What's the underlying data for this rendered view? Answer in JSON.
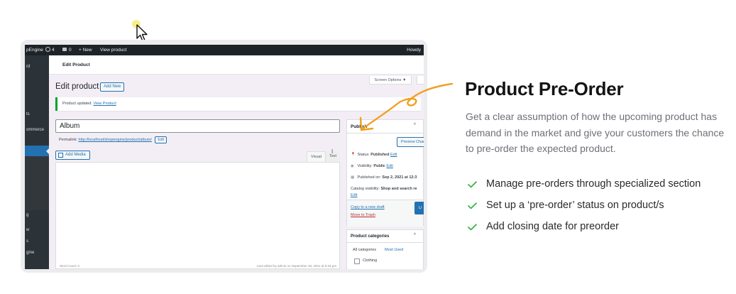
{
  "cursor": {
    "icon": "mouse-pointer-icon"
  },
  "wp": {
    "admin_bar": {
      "brand": "pEngine",
      "updates_count": "4",
      "comments_count": "0",
      "new_label": "+ New",
      "view_product": "View product",
      "howdy": "Howdy"
    },
    "sidebar_items": [
      "rd",
      "ts",
      "ommerce",
      "g",
      "w",
      "s",
      "gine"
    ],
    "top_title": "Edit Product",
    "screen_options": "Screen Options ▼",
    "page_title": "Edit product",
    "add_new": "Add New",
    "notice_text": "Product updated.",
    "notice_link": "View Product",
    "title_value": "Album",
    "permalink_label": "Permalink:",
    "permalink_url": "http://localhost/shopengine/product/album/",
    "permalink_edit": "Edit",
    "add_media": "Add Media",
    "tab_visual": "Visual",
    "tab_text": "Text",
    "editor_footer_left": "Word count: 0",
    "editor_footer_right": "Last edited by admin on September 28, 2021 at 5:33 pm",
    "publish": {
      "heading": "Publish",
      "preview": "Preview Changes",
      "status_label": "Status:",
      "status_value": "Published",
      "status_edit": "Edit",
      "visibility_label": "Visibility:",
      "visibility_value": "Public",
      "visibility_edit": "Edit",
      "published_on_label": "Published on:",
      "published_on_value": "Sep 2, 2021 at 12:3",
      "catalog_label": "Catalog visibility:",
      "catalog_value": "Shop and search re",
      "catalog_edit": "Edit",
      "copy_draft": "Copy to a new draft",
      "move_trash": "Move to Trash",
      "update": "U"
    },
    "categories": {
      "heading": "Product categories",
      "tab_all": "All categories",
      "tab_used": "Most Used",
      "item": "Clothing"
    }
  },
  "feature": {
    "title": "Product Pre-Order",
    "description": "Get a clear assumption of how the upcoming product has demand in the market and give your customers the chance to pre-order the expected product.",
    "benefits": [
      "Manage pre-orders through specialized section",
      "Set up a ‘pre-order’ status on product/s",
      "Add closing date for preorder"
    ]
  },
  "colors": {
    "accent_arrow": "#f0a01e",
    "check": "#3bb54a",
    "wp_blue": "#2271b1",
    "admin_bar": "#1d2327"
  }
}
